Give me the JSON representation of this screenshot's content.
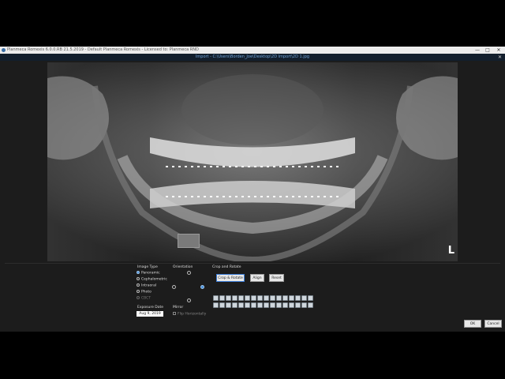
{
  "window": {
    "title": "Planmeca Romexis 6.0.0.RB 21.5.2019 - Default Planmeca Romexis - Licensed to: Planmeca RND",
    "controls": {
      "minimize": "—",
      "maximize": "□",
      "close": "✕"
    }
  },
  "dialog": {
    "title": "Import - C:\\Users\\Borden_Joe\\Desktop\\2D Import\\2D 1.jpg",
    "close": "✕",
    "corner_marker": "L"
  },
  "image_type": {
    "label": "Image Type",
    "options": [
      "Panoramic",
      "Cephalometric",
      "Intraoral",
      "Photo",
      "CBCT"
    ],
    "selected": "Panoramic"
  },
  "orientation": {
    "label": "Orientation",
    "selected": "right"
  },
  "crop": {
    "label": "Crop and Rotate",
    "buttons": {
      "crop_rotate": "Crop & Rotate",
      "align": "Align",
      "reset": "Reset"
    }
  },
  "exposure": {
    "label": "Exposure Date",
    "value": "Aug 9, 2019"
  },
  "mirror": {
    "label": "Mirror",
    "checkbox": "Flip Horizontally",
    "checked": false
  },
  "tooth_chart": {
    "rows": 2,
    "per_row": 16
  },
  "footer": {
    "ok": "OK",
    "cancel": "Cancel"
  },
  "colors": {
    "accent": "#4a90d9",
    "dialog_title": "#6fa3d8",
    "background": "#1c1c1c"
  }
}
